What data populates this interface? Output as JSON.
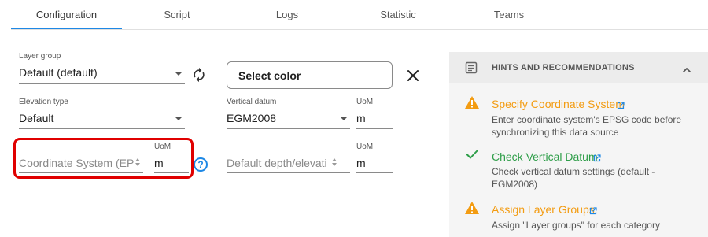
{
  "tabs": [
    {
      "label": "Configuration"
    },
    {
      "label": "Script"
    },
    {
      "label": "Logs"
    },
    {
      "label": "Statistic"
    },
    {
      "label": "Teams"
    }
  ],
  "active_tab": "Configuration",
  "form": {
    "layer_group": {
      "label": "Layer group",
      "value": "Default (default)"
    },
    "select_color_label": "Select color",
    "elevation_type": {
      "label": "Elevation type",
      "value": "Default"
    },
    "vertical_datum": {
      "label": "Vertical datum",
      "value": "EGM2008"
    },
    "vertical_datum_uom": {
      "label": "UoM",
      "value": "m"
    },
    "coordinate_system": {
      "placeholder": "Coordinate System (EP"
    },
    "coordinate_system_uom": {
      "label": "UoM",
      "value": "m"
    },
    "default_depth": {
      "placeholder": "Default depth/elevati"
    },
    "default_depth_uom": {
      "label": "UoM",
      "value": "m"
    }
  },
  "hints": {
    "title": "HINTS AND RECOMMENDATIONS",
    "items": [
      {
        "status": "warning",
        "title": "Specify Coordinate System",
        "description": "Enter coordinate system's EPSG code before synchronizing this data source"
      },
      {
        "status": "ok",
        "title": "Check Vertical Datum",
        "description": "Check vertical datum settings (default - EGM2008)"
      },
      {
        "status": "warning",
        "title": "Assign Layer Groups",
        "description": "Assign \"Layer groups\" for each category"
      }
    ]
  },
  "colors": {
    "accent": "#1e88e5",
    "warning": "#f39c12",
    "success": "#2e9e49",
    "highlight": "#e00000"
  }
}
